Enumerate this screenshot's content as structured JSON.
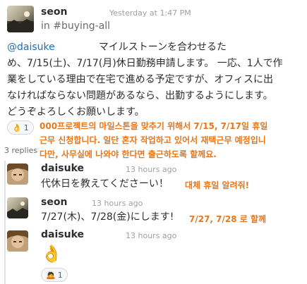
{
  "thread": {
    "root": {
      "author": "seon",
      "timestamp": "Yesterday at 1:47 PM",
      "channel": "in #buying-all",
      "mention": "@daisuke",
      "line1_rest": "マイルストーンを合わせるた",
      "line2": "め、7/15(土)、7/17(月)休日勤務申請します。 一応、1人で作",
      "line3": "業をしている理由で在宅で進める予定ですが、オフィスに出",
      "line4": "なければならない問題があるなら、出勤するようにします。",
      "line5": "どうぞよろしくお願いします。",
      "reaction_emoji": "👌",
      "reaction_count": "1",
      "annotation_line1": "000프로젝트의 마일스톤을 맞추기 위해서 7/15, 7/17일 휴일",
      "annotation_line2": "근무 신청합니다. 일단 혼자 작업하고 있어서 재택근무 예정입니",
      "annotation_line3": "다만, 사무실에 나와야 한다면 출근하도록 할께요.",
      "replies_label": "3 replies"
    },
    "replies": [
      {
        "author": "daisuke",
        "timestamp": "13 hours ago",
        "text": "代休日を教えてくださーい！",
        "annotation": "대체 휴일 알려줘!"
      },
      {
        "author": "seon",
        "timestamp": "13 hours ago",
        "text": "7/27(木)、7/28(金)にします!",
        "annotation": "7/27, 7/28 로 할께"
      },
      {
        "author": "daisuke",
        "timestamp": "13 hours ago",
        "emoji": "👌",
        "reaction_emoji": "🙇",
        "reaction_count": "1"
      }
    ]
  },
  "colors": {
    "annotation": "#e8761a",
    "link": "#1f6fb2",
    "muted": "#9e9ea6"
  }
}
